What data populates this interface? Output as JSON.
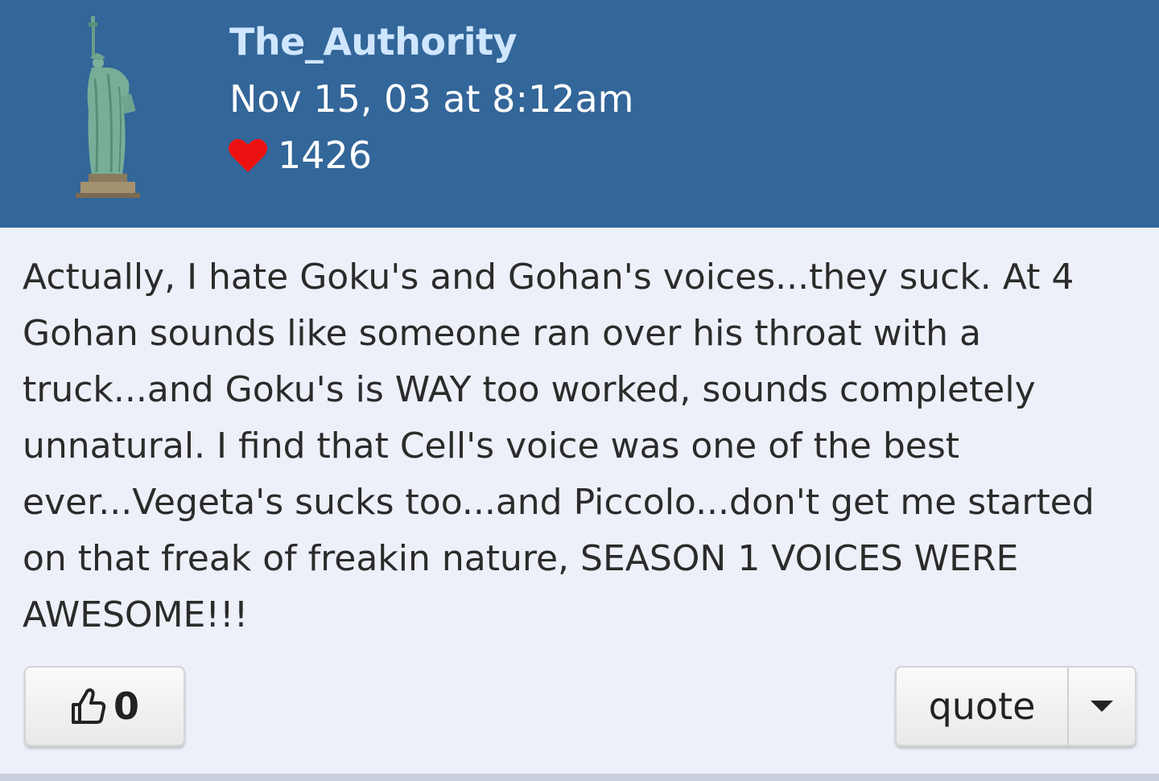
{
  "post": {
    "username": "The_Authority",
    "timestamp": "Nov 15, 03 at 8:12am",
    "reputation": "1426",
    "body": "Actually, I hate Goku's and Gohan's voices...they suck. At 4 Gohan sounds like someone ran over his throat with a truck...and Goku's is WAY too worked, sounds completely unnatural. I find that Cell's voice was one of the best ever...Vegeta's sucks too...and Piccolo...don't get me started on that freak of freakin nature, SEASON 1 VOICES WERE AWESOME!!!",
    "like_count": "0",
    "quote_label": "quote"
  },
  "icons": {
    "avatar": "statue-of-liberty",
    "reputation": "heart-icon",
    "like": "thumbs-up-icon",
    "dropdown": "caret-down-icon"
  },
  "colors": {
    "header_bg": "#336699",
    "username": "#cfe6ff",
    "heart": "#ee1111",
    "page_bg": "#edf0f8"
  }
}
